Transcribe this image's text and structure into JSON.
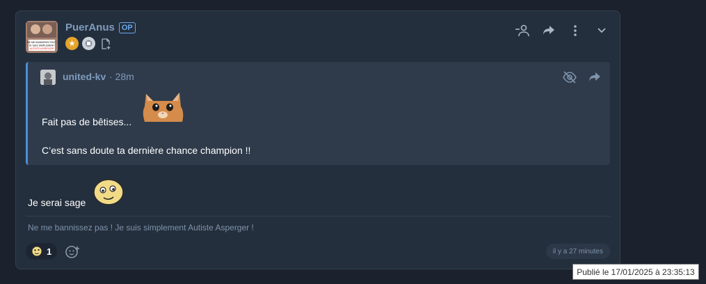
{
  "post": {
    "author": "PuerAnus",
    "op_badge": "OP",
    "avatar_sign_text": [
      "NE ME BANNISSEZ PAS !",
      "JE SUIS SIMPLEMENT",
      "AUTISTE ASPERGER"
    ],
    "icons": {
      "badges": [
        "star-badge-icon",
        "gray-badge-icon",
        "document-add-icon"
      ],
      "actions": [
        "remove-user-icon",
        "share-icon",
        "more-options-icon",
        "chevron-down-icon"
      ]
    }
  },
  "quote": {
    "author": "united-kv",
    "time": "· 28m",
    "line1": "Fait pas de bêtises...",
    "line2": "C’est sans doute ta dernière chance champion !!",
    "icons": [
      "hide-eye-icon",
      "share-icon"
    ]
  },
  "body": {
    "text": "Je serai sage"
  },
  "signature": "Ne me bannissez pas ! Je suis simplement Autiste Asperger !",
  "reaction": {
    "count": "1"
  },
  "time_pill": "il y a 27 minutes",
  "tooltip": "Publié le 17/01/2025 à 23:35:13",
  "colors": {
    "background": "#1b222d",
    "card": "#242f3d",
    "quote_bg": "#2f3b4b",
    "accent": "#4c8fd6",
    "username": "#7f9bbd"
  }
}
